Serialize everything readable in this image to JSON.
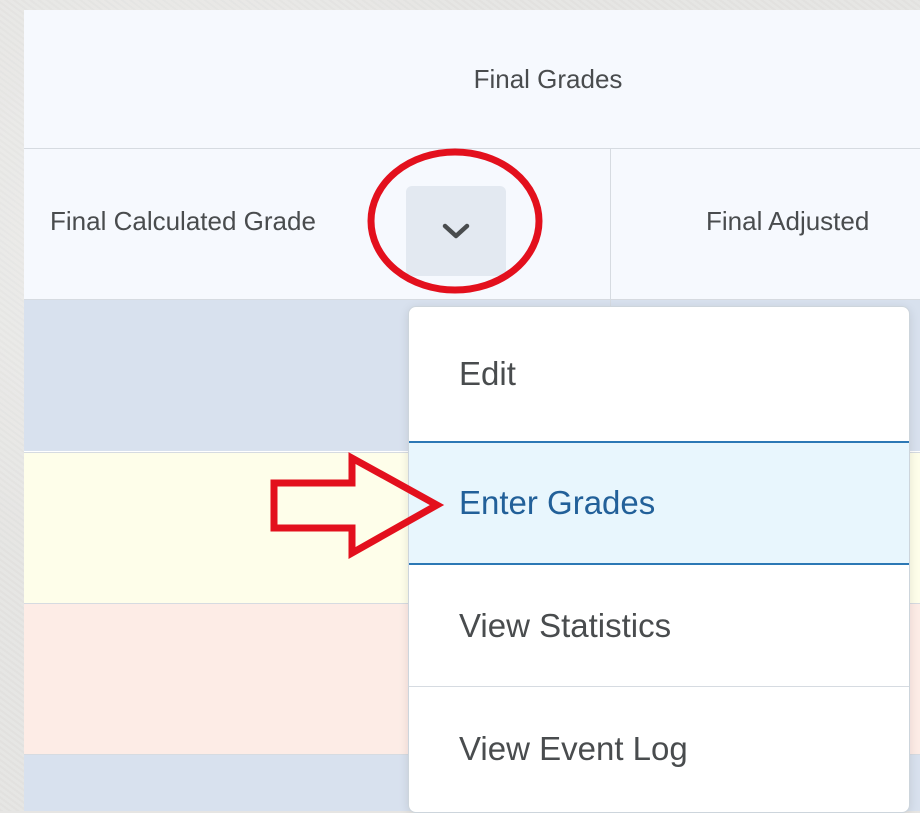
{
  "header": {
    "group_title": "Final Grades"
  },
  "columns": [
    {
      "label": "Final Calculated Grade"
    },
    {
      "label": "Final Adjusted"
    }
  ],
  "dropdown_icon": "chevron-down-icon",
  "menu": {
    "items": [
      {
        "label": "Edit"
      },
      {
        "label": "Enter Grades",
        "highlighted": true
      },
      {
        "label": "View Statistics"
      },
      {
        "label": "View Event Log"
      }
    ]
  },
  "row_colors": [
    "#d8e1ee",
    "#fefeea",
    "#fdece6",
    "#d8e1ee"
  ],
  "annotation_color": "#e3101d"
}
